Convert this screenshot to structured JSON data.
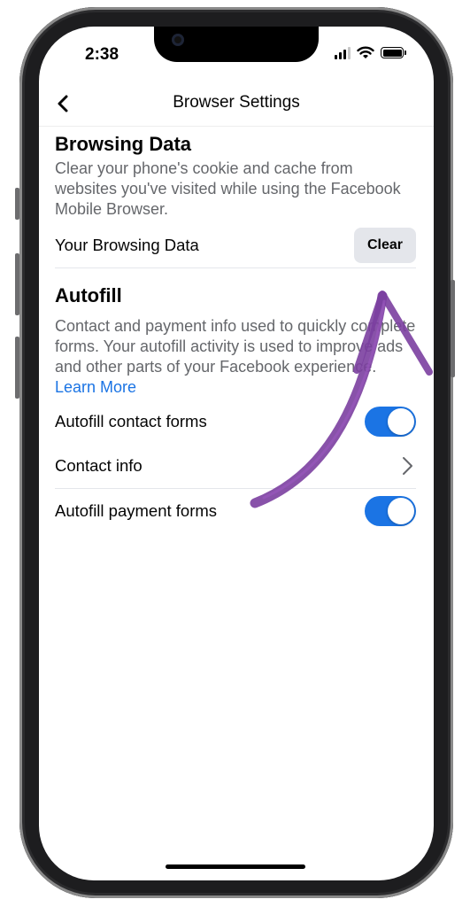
{
  "status_bar": {
    "time": "2:38"
  },
  "nav": {
    "title": "Browser Settings"
  },
  "browsing_data": {
    "title": "Browsing Data",
    "description": "Clear your phone's cookie and cache from websites you've visited while using the Facebook Mobile Browser.",
    "row_label": "Your Browsing Data",
    "clear_label": "Clear"
  },
  "autofill": {
    "title": "Autofill",
    "description": "Contact and payment info used to quickly complete forms. Your autofill activity is used to improve ads and other parts of your Facebook experience.",
    "learn_more": "Learn More",
    "contact_forms_label": "Autofill contact forms",
    "contact_forms_on": true,
    "contact_info_label": "Contact info",
    "payment_forms_label": "Autofill payment forms",
    "payment_forms_on": true
  },
  "colors": {
    "accent": "#1b74e4",
    "annotation": "#7b3fa0"
  }
}
